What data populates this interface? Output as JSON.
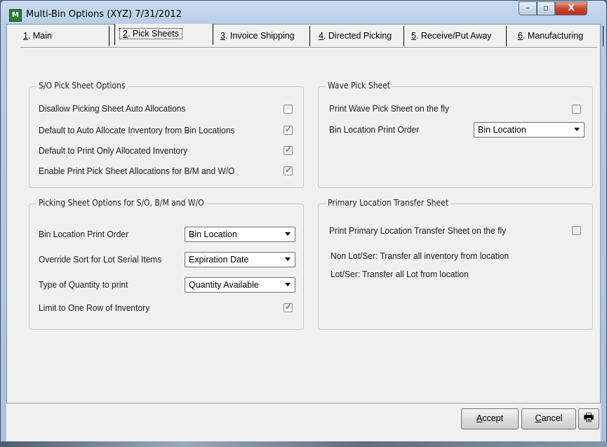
{
  "window": {
    "title": "Multi-Bin Options (XYZ) 7/31/2012",
    "app_icon_text": "M",
    "minimize": "–",
    "maximize": "▫",
    "close": "X"
  },
  "tabs": [
    {
      "key": "1",
      "label": ". Main"
    },
    {
      "key": "2",
      "label": ". Pick Sheets"
    },
    {
      "key": "3",
      "label": ". Invoice Shipping"
    },
    {
      "key": "4",
      "label": ". Directed Picking"
    },
    {
      "key": "5",
      "label": ". Receive/Put Away"
    },
    {
      "key": "6",
      "label": ". Manufacturing"
    }
  ],
  "active_tab": "2. Pick Sheets",
  "so_pick": {
    "title": "S/O Pick Sheet Options",
    "rows": [
      {
        "label": "Disallow Picking Sheet Auto Allocations",
        "checked": false
      },
      {
        "label": "Default to Auto Allocate Inventory from Bin Locations",
        "checked": true
      },
      {
        "label": "Default to Print Only Allocated Inventory",
        "checked": true
      },
      {
        "label": "Enable Print Pick Sheet Allocations for B/M and W/O",
        "checked": true
      }
    ]
  },
  "wave": {
    "title": "Wave Pick Sheet",
    "print_label": "Print Wave Pick Sheet on the fly",
    "print_checked": false,
    "order_label": "Bin Location Print Order",
    "order_value": "Bin Location"
  },
  "picking": {
    "title": "Picking Sheet Options for S/O, B/M and W/O",
    "order_label": "Bin Location Print Order",
    "order_value": "Bin Location",
    "sort_label": "Override Sort for Lot Serial Items",
    "sort_value": "Expiration Date",
    "qty_label": "Type of Quantity to print",
    "qty_value": "Quantity Available",
    "limit_label": "Limit to One Row of Inventory",
    "limit_checked": true
  },
  "primary": {
    "title": "Primary Location Transfer Sheet",
    "print_label": "Print Primary Location Transfer Sheet on the fly",
    "print_checked": false,
    "note1": "Non Lot/Ser: Transfer all inventory from location",
    "note2": "Lot/Ser: Transfer all Lot from location"
  },
  "buttons": {
    "accept_key": "A",
    "accept_rest": "ccept",
    "cancel_key": "C",
    "cancel_rest": "ancel",
    "print_icon": "🖶"
  }
}
